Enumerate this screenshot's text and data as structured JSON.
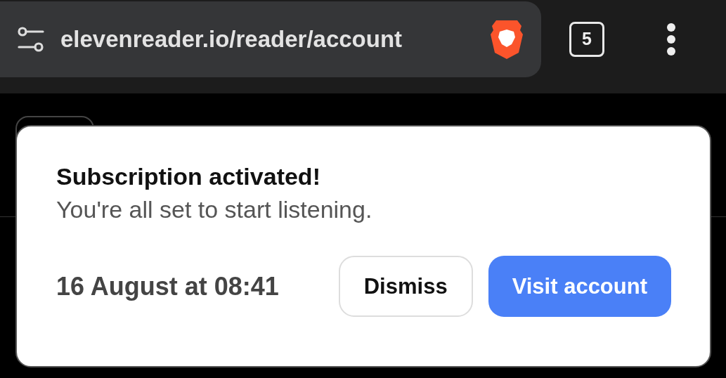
{
  "address_bar": {
    "url": "elevenreader.io/reader/account",
    "tab_count": "5"
  },
  "notification": {
    "title": "Subscription activated!",
    "message": "You're all set to start listening.",
    "time": "16 August at 08:41",
    "buttons": [
      {
        "label": "Dismiss",
        "kind": "secondary"
      },
      {
        "label": "Visit account",
        "kind": "primary"
      }
    ]
  }
}
